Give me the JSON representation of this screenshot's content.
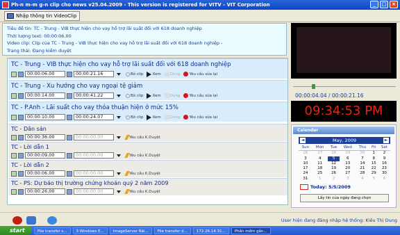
{
  "window": {
    "title": "Ph-n m-m g-n clip cho news v25.04.2009 - This version is registered for VITV - VIT Corporation",
    "buttons": [
      "_",
      "□",
      "×"
    ]
  },
  "toolbar": {
    "nhap_label": "Nhập thông tin VideoClip"
  },
  "info": {
    "line1": "Tiêu đề tin: TC - Trung - VIB thực hiện cho vay hỗ trợ lãi suất đối với 618 doanh nghiệp",
    "line2": "Thời lượng text: 00:00:06.00",
    "line3": "Video clip: Clip của TC - Trung - VIB thực hiện cho vay hỗ trợ lãi suất đối với 618 doanh nghiệp -",
    "line4": "Trạng thái: Đang kiểm duyệt"
  },
  "actions": {
    "cut": "Bỏ clip",
    "view": "Xem",
    "use": "Dùng",
    "request": "Yêu cầu sửa lại",
    "approve": "Yêu cầu K.Duyệt"
  },
  "items": [
    {
      "title": "TC - Trung - VIB thực hiện cho vay hỗ trợ lãi suất đối với 618 doanh nghiệp",
      "start": "00:00:06.00",
      "end": "00:00:21.16"
    },
    {
      "title": "TC - Trung - Xu hướng cho vay ngoại tệ giảm",
      "start": "00:00:14.00",
      "end": "00:00:41.22"
    },
    {
      "title": "TC - P.Anh - Lãi suất cho vay thỏa thuận hiện ở mức 15%",
      "start": "00:00:10.00",
      "end": "00:00:24.07"
    },
    {
      "title": "TC - Dân sản",
      "start": "00:00:36.00",
      "end": "00:00:00.00"
    },
    {
      "title": "TC - Lời dẫn 1",
      "start": "00:00:09.00",
      "end": "00:00:00.00"
    },
    {
      "title": "TC - Lời dẫn 2",
      "start": "00:00:06.00",
      "end": "00:00:00.00"
    },
    {
      "title": "TC - PS: Dự báo thị trường chứng khoán quý 2 năm 2009",
      "start": "00:00:26.00",
      "end": "00:00:00.00"
    }
  ],
  "player": {
    "timecode": "00:00:04.04 / 00:00:21.16",
    "position_fraction": 0.19,
    "clock": "09:34:53 PM"
  },
  "calendar": {
    "header": "Calendar",
    "month": "May, 2009",
    "prev": "◄",
    "next": "►",
    "days": [
      "Sun",
      "Mon",
      "Tue",
      "Wed",
      "Thu",
      "Fri",
      "Sat"
    ],
    "weeks": [
      [
        "26",
        "27",
        "28",
        "29",
        "30",
        "1",
        "2"
      ],
      [
        "3",
        "4",
        "5",
        "6",
        "7",
        "8",
        "9"
      ],
      [
        "10",
        "11",
        "12",
        "13",
        "14",
        "15",
        "16"
      ],
      [
        "17",
        "18",
        "19",
        "20",
        "21",
        "22",
        "23"
      ],
      [
        "24",
        "25",
        "26",
        "27",
        "28",
        "29",
        "30"
      ],
      [
        "31",
        "1",
        "2",
        "3",
        "4",
        "5",
        "6"
      ]
    ],
    "today": "Today: 5/5/2009",
    "pick": "Lấy tin của ngày đang chọn"
  },
  "status": "User hiện đang đăng nhập hệ thống: Kiều Thị Dung",
  "taskbar": {
    "start": "start",
    "items": [
      "File transfer s...",
      "3 Windows E...",
      "ImageServer Rãi...",
      "File transfer d...",
      "172.26.14.31...",
      "Phần mềm gắn..."
    ]
  }
}
